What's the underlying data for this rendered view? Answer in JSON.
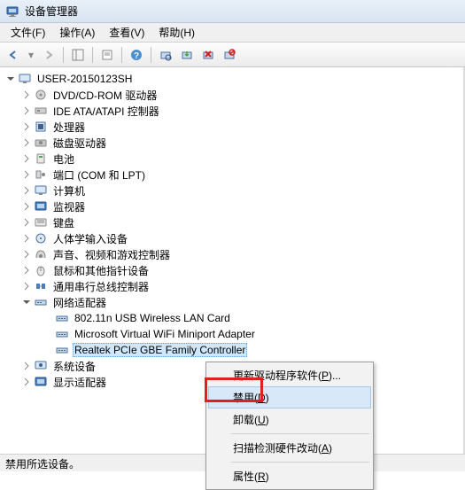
{
  "title": "设备管理器",
  "menus": {
    "file": "文件(F)",
    "action": "操作(A)",
    "view": "查看(V)",
    "help": "帮助(H)"
  },
  "root": "USER-20150123SH",
  "categories": [
    "DVD/CD-ROM 驱动器",
    "IDE ATA/ATAPI 控制器",
    "处理器",
    "磁盘驱动器",
    "电池",
    "端口 (COM 和 LPT)",
    "计算机",
    "监视器",
    "键盘",
    "人体学输入设备",
    "声音、视频和游戏控制器",
    "鼠标和其他指针设备",
    "通用串行总线控制器"
  ],
  "net_label": "网络适配器",
  "net_items": [
    "802.11n USB Wireless LAN Card",
    "Microsoft Virtual WiFi Miniport Adapter",
    "Realtek PCIe GBE Family Controller"
  ],
  "tail": [
    "系统设备",
    "显示适配器"
  ],
  "ctx": {
    "update": "更新驱动程序软件(P)...",
    "disable": "禁用(D)",
    "uninstall": "卸载(U)",
    "scan": "扫描检测硬件改动(A)",
    "props": "属性(R)"
  },
  "status": "禁用所选设备。"
}
